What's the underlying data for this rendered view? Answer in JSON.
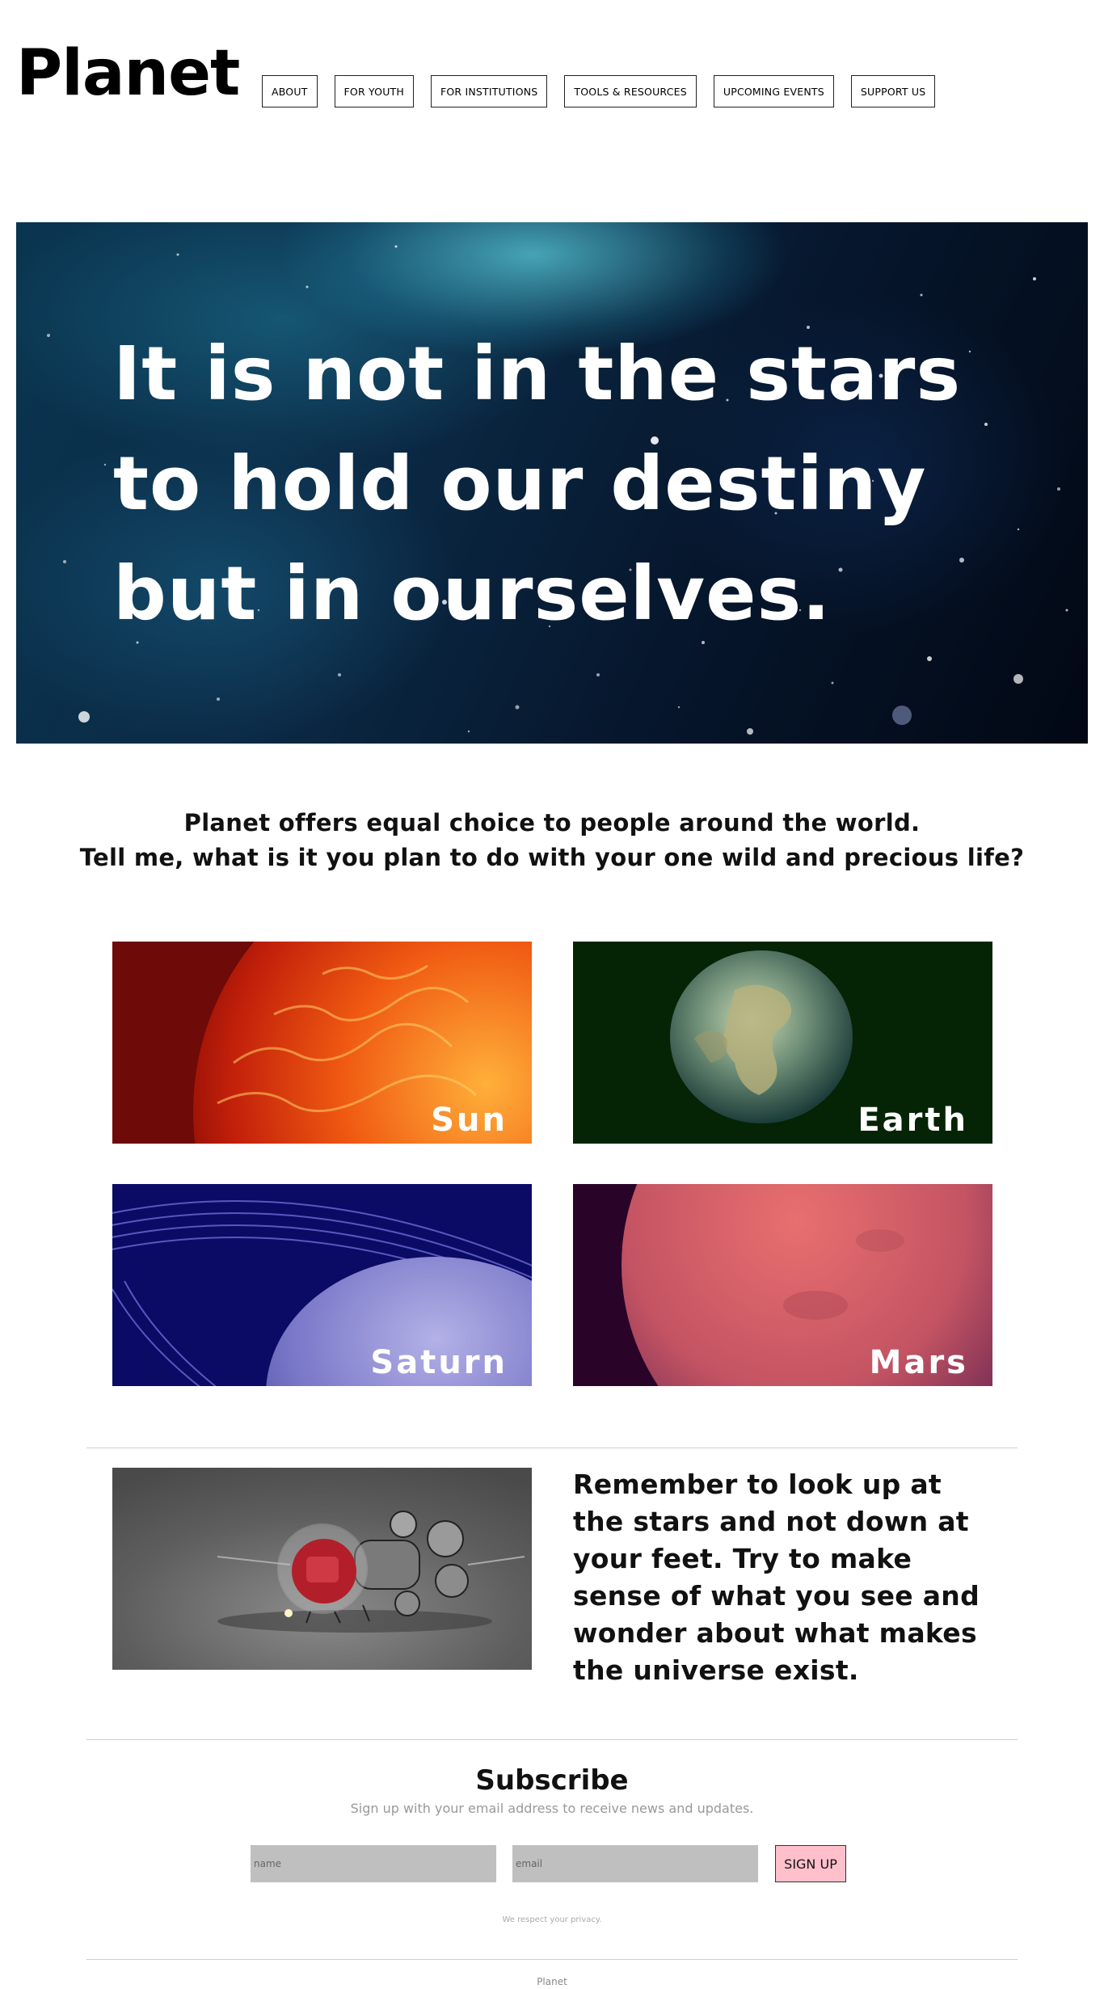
{
  "header": {
    "logo": "Planet",
    "nav": [
      "ABOUT",
      "FOR YOUTH",
      "FOR INSTITUTIONS",
      "TOOLS & RESOURCES",
      "UPCOMING EVENTS",
      "SUPPORT US"
    ]
  },
  "hero": {
    "lines": [
      "It is not in the stars",
      "to hold our destiny",
      "but in ourselves."
    ]
  },
  "intro": {
    "line1": "Planet offers equal choice to people around the world.",
    "line2": "Tell me, what is it you plan to do with your one wild and precious life?"
  },
  "planets": [
    {
      "label": "Sun",
      "bg": "#7a0a08"
    },
    {
      "label": "Earth",
      "bg": "#062a06"
    },
    {
      "label": "Saturn",
      "bg": "#0c0c6a"
    },
    {
      "label": "Mars",
      "bg": "#2a0428"
    }
  ],
  "feature": {
    "text": "Remember to look up at the stars and not down at your feet. Try to make sense of what you see and wonder about what makes the universe exist."
  },
  "subscribe": {
    "title": "Subscribe",
    "description": "Sign up with your email address to receive news and updates.",
    "name_placeholder": "name",
    "email_placeholder": "email",
    "button": "SIGN UP",
    "privacy": "We respect your privacy."
  },
  "footer": {
    "text": "Planet"
  }
}
